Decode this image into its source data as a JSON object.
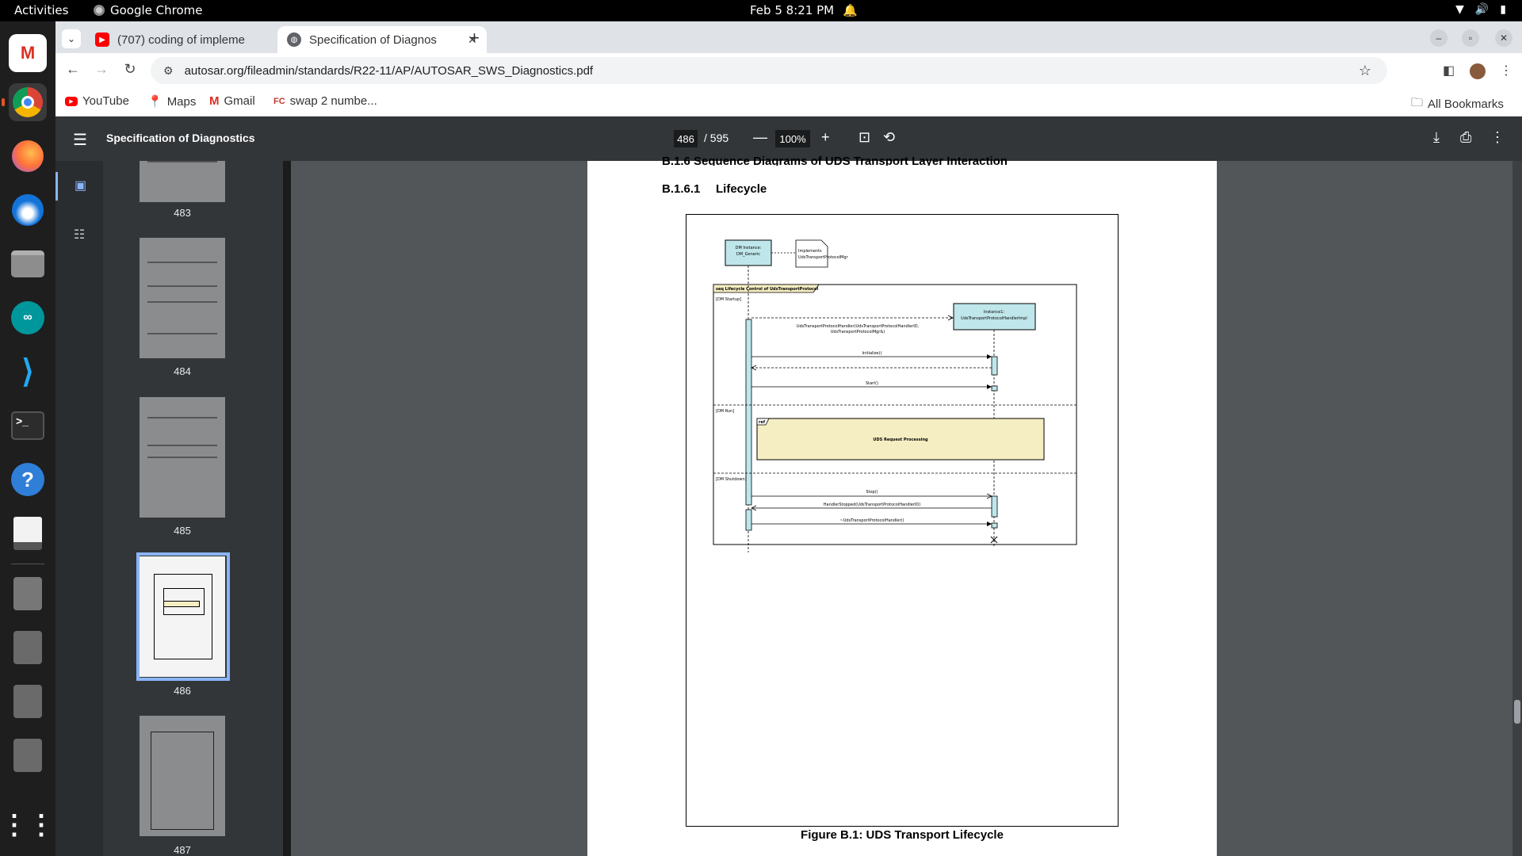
{
  "topbar": {
    "activities": "Activities",
    "app_name": "Google Chrome",
    "clock": "Feb 5  8:21 PM"
  },
  "dock": {
    "items": [
      "gmail-icon",
      "chrome-icon",
      "firefox-icon",
      "thunderbird-icon",
      "files-icon",
      "arduino-icon",
      "vscode-icon",
      "terminal-icon",
      "help-icon",
      "document-viewer-icon",
      "app-grid-icon"
    ]
  },
  "browser": {
    "tabs": [
      {
        "title": "(707) coding of impleme",
        "favicon_color": "#ff0000"
      },
      {
        "title": "Specification of Diagnos",
        "favicon_color": "#5f6368"
      }
    ],
    "url": "autosar.org/fileadmin/standards/R22-11/AP/AUTOSAR_SWS_Diagnostics.pdf",
    "bookmarks": [
      "YouTube",
      "Maps",
      "Gmail",
      "swap 2 numbe..."
    ],
    "all_bookmarks": "All Bookmarks"
  },
  "pdf": {
    "title": "Specification of Diagnostics",
    "current_page": "486",
    "total_pages": "/ 595",
    "zoom": "100%",
    "section_heading_cut": "B.1.6   Sequence Diagrams of UDS Transport Layer Interaction",
    "section": "B.1.6.1",
    "section_title": "Lifecycle",
    "caption": "Figure B.1: UDS Transport Lifecycle",
    "thumbnails": [
      {
        "page": "483"
      },
      {
        "page": "484"
      },
      {
        "page": "485"
      },
      {
        "page": "486"
      },
      {
        "page": "487"
      }
    ]
  },
  "diagram": {
    "dm_instance": [
      "DM Instance:",
      "DM_Generic"
    ],
    "note": [
      "Implements",
      "UdsTransportProtocolMgr"
    ],
    "frame_title": "seq Lifecycle Control of UdsTransportProtocol",
    "lifeline2": [
      "Instance1:",
      "UdsTransportProtocolHandlerImpl"
    ],
    "guard_startup": "[DM Startup]",
    "guard_run": "[DM Run]",
    "guard_shutdown": "[DM Shutdown]",
    "create_msg": [
      "UdsTransportProtocolHandler(UdsTransportProtocolHandlerID,",
      "UdsTransportProtocolMgr&)"
    ],
    "msg_initialize": "Initialize()",
    "msg_start": "Start()",
    "ref_tag": "ref",
    "ref_text": "UDS Request Processing",
    "msg_stop": "Stop()",
    "msg_handler_stopped": "HandlerStopped(UdsTransportProtocolHandlerID)",
    "msg_destroy": "~UdsTransportProtocolHandler()"
  }
}
